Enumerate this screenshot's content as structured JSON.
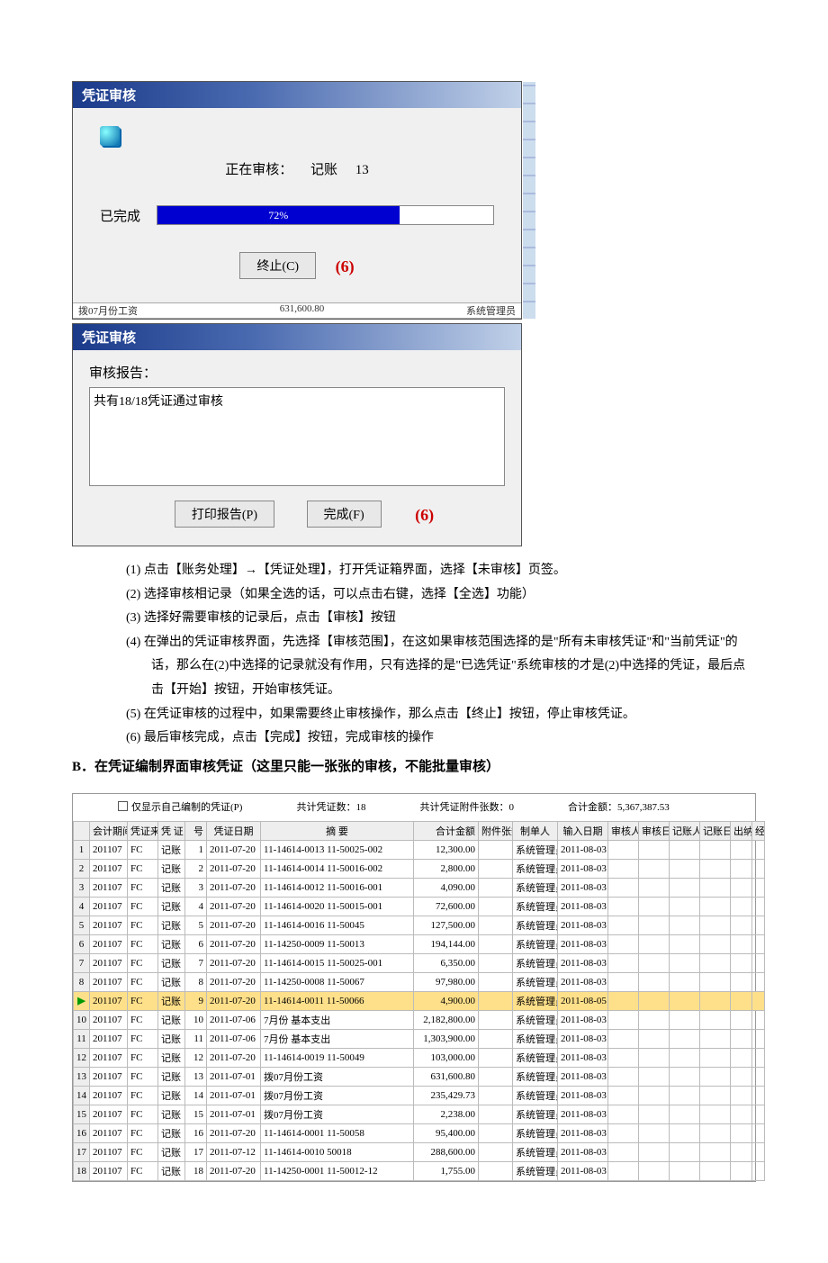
{
  "progress_dialog": {
    "title": "凭证审核",
    "status_prefix": "正在审核：",
    "status_type": "记账",
    "status_num": "13",
    "done_label": "已完成",
    "percent_text": "72%",
    "cancel_btn": "终止(C)",
    "annot": "(6)",
    "truncated_left": "拨07月份工资",
    "truncated_mid": "631,600.80",
    "truncated_right": "系统管理员"
  },
  "report_dialog": {
    "title": "凭证审核",
    "label": "审核报告：",
    "content": "共有18/18凭证通过审核",
    "print_btn": "打印报告(P)",
    "finish_btn": "完成(F)",
    "annot": "(6)"
  },
  "steps": {
    "s1": "(1) 点击【账务处理】→【凭证处理】，打开凭证箱界面，选择【未审核】页签。",
    "s2": "(2) 选择审核相记录（如果全选的话，可以点击右键，选择【全选】功能）",
    "s3": "(3) 选择好需要审核的记录后，点击【审核】按钮",
    "s4": "(4) 在弹出的凭证审核界面，先选择【审核范围】，在这如果审核范围选择的是\"所有未审核凭证\"和\"当前凭证\"的话，那么在(2)中选择的记录就没有作用，只有选择的是\"已选凭证\"系统审核的才是(2)中选择的凭证，最后点击【开始】按钮，开始审核凭证。",
    "s5": "(5) 在凭证审核的过程中，如果需要终止审核操作，那么点击【终止】按钮，停止审核凭证。",
    "s6": "(6) 最后审核完成，点击【完成】按钮，完成审核的操作"
  },
  "section_b": "B．在凭证编制界面审核凭证（这里只能一张张的审核，不能批量审核）",
  "table_toolbar": {
    "checkbox_label": "仅显示自己编制的凭证(P)",
    "count_label": "共计凭证数：",
    "count_val": "18",
    "att_label": "共计凭证附件张数：",
    "att_val": "0",
    "amt_label": "合计金额：",
    "amt_val": "5,367,387.53"
  },
  "table_headers": [
    "会计期间",
    "凭证来源",
    "凭 证",
    "号",
    "凭证日期",
    "摘        要",
    "合计金额",
    "附件张数",
    "制单人",
    "输入日期",
    "审核人",
    "审核日期",
    "记账人",
    "记账日期",
    "出纳",
    "经"
  ],
  "rows": [
    {
      "n": "1",
      "period": "201107",
      "src": "FC",
      "type": "记账",
      "no": "1",
      "date": "2011-07-20",
      "summary": "11-14614-0013 11-50025-002",
      "amt": "12,300.00",
      "maker": "系统管理员",
      "indate": "2011-08-03"
    },
    {
      "n": "2",
      "period": "201107",
      "src": "FC",
      "type": "记账",
      "no": "2",
      "date": "2011-07-20",
      "summary": "11-14614-0014 11-50016-002",
      "amt": "2,800.00",
      "maker": "系统管理员",
      "indate": "2011-08-03"
    },
    {
      "n": "3",
      "period": "201107",
      "src": "FC",
      "type": "记账",
      "no": "3",
      "date": "2011-07-20",
      "summary": "11-14614-0012 11-50016-001",
      "amt": "4,090.00",
      "maker": "系统管理员",
      "indate": "2011-08-03"
    },
    {
      "n": "4",
      "period": "201107",
      "src": "FC",
      "type": "记账",
      "no": "4",
      "date": "2011-07-20",
      "summary": "11-14614-0020 11-50015-001",
      "amt": "72,600.00",
      "maker": "系统管理员",
      "indate": "2011-08-03"
    },
    {
      "n": "5",
      "period": "201107",
      "src": "FC",
      "type": "记账",
      "no": "5",
      "date": "2011-07-20",
      "summary": "11-14614-0016 11-50045",
      "amt": "127,500.00",
      "maker": "系统管理员",
      "indate": "2011-08-03"
    },
    {
      "n": "6",
      "period": "201107",
      "src": "FC",
      "type": "记账",
      "no": "6",
      "date": "2011-07-20",
      "summary": "11-14250-0009 11-50013",
      "amt": "194,144.00",
      "maker": "系统管理员",
      "indate": "2011-08-03"
    },
    {
      "n": "7",
      "period": "201107",
      "src": "FC",
      "type": "记账",
      "no": "7",
      "date": "2011-07-20",
      "summary": "11-14614-0015 11-50025-001",
      "amt": "6,350.00",
      "maker": "系统管理员",
      "indate": "2011-08-03"
    },
    {
      "n": "8",
      "period": "201107",
      "src": "FC",
      "type": "记账",
      "no": "8",
      "date": "2011-07-20",
      "summary": "11-14250-0008 11-50067",
      "amt": "97,980.00",
      "maker": "系统管理员",
      "indate": "2011-08-03"
    },
    {
      "n": "9",
      "period": "201107",
      "src": "FC",
      "type": "记账",
      "no": "9",
      "date": "2011-07-20",
      "summary": "11-14614-0011 11-50066",
      "amt": "4,900.00",
      "maker": "系统管理员",
      "indate": "2011-08-05",
      "hl": true,
      "arrow": true
    },
    {
      "n": "10",
      "period": "201107",
      "src": "FC",
      "type": "记账",
      "no": "10",
      "date": "2011-07-06",
      "summary": "7月份 基本支出",
      "amt": "2,182,800.00",
      "maker": "系统管理员",
      "indate": "2011-08-03"
    },
    {
      "n": "11",
      "period": "201107",
      "src": "FC",
      "type": "记账",
      "no": "11",
      "date": "2011-07-06",
      "summary": "7月份 基本支出",
      "amt": "1,303,900.00",
      "maker": "系统管理员",
      "indate": "2011-08-03"
    },
    {
      "n": "12",
      "period": "201107",
      "src": "FC",
      "type": "记账",
      "no": "12",
      "date": "2011-07-20",
      "summary": "11-14614-0019 11-50049",
      "amt": "103,000.00",
      "maker": "系统管理员",
      "indate": "2011-08-03"
    },
    {
      "n": "13",
      "period": "201107",
      "src": "FC",
      "type": "记账",
      "no": "13",
      "date": "2011-07-01",
      "summary": "拨07月份工资",
      "amt": "631,600.80",
      "maker": "系统管理员",
      "indate": "2011-08-03"
    },
    {
      "n": "14",
      "period": "201107",
      "src": "FC",
      "type": "记账",
      "no": "14",
      "date": "2011-07-01",
      "summary": "拨07月份工资",
      "amt": "235,429.73",
      "maker": "系统管理员",
      "indate": "2011-08-03"
    },
    {
      "n": "15",
      "period": "201107",
      "src": "FC",
      "type": "记账",
      "no": "15",
      "date": "2011-07-01",
      "summary": "拨07月份工资",
      "amt": "2,238.00",
      "maker": "系统管理员",
      "indate": "2011-08-03"
    },
    {
      "n": "16",
      "period": "201107",
      "src": "FC",
      "type": "记账",
      "no": "16",
      "date": "2011-07-20",
      "summary": "11-14614-0001 11-50058",
      "amt": "95,400.00",
      "maker": "系统管理员",
      "indate": "2011-08-03"
    },
    {
      "n": "17",
      "period": "201107",
      "src": "FC",
      "type": "记账",
      "no": "17",
      "date": "2011-07-12",
      "summary": "11-14614-0010 50018",
      "amt": "288,600.00",
      "maker": "系统管理员",
      "indate": "2011-08-03"
    },
    {
      "n": "18",
      "period": "201107",
      "src": "FC",
      "type": "记账",
      "no": "18",
      "date": "2011-07-20",
      "summary": "11-14250-0001 11-50012-12",
      "amt": "1,755.00",
      "maker": "系统管理员",
      "indate": "2011-08-03"
    }
  ]
}
